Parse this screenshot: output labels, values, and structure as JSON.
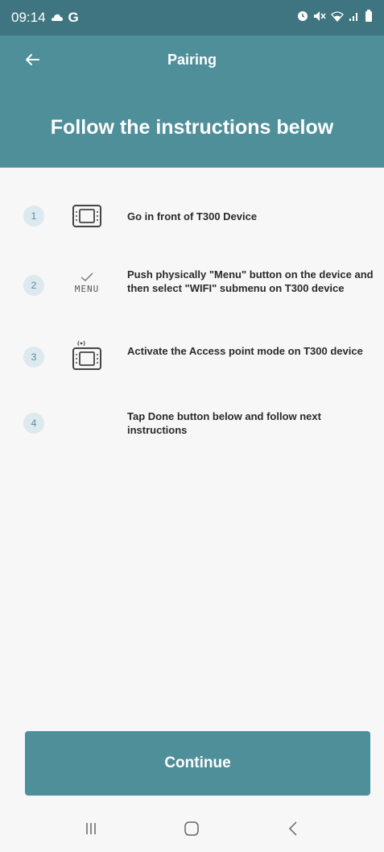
{
  "status_bar": {
    "time": "09:14",
    "carrier_letter": "G"
  },
  "app_bar": {
    "title": "Pairing",
    "headline": "Follow the instructions below"
  },
  "steps": [
    {
      "number": "1",
      "text": "Go in front of T300 Device",
      "icon": "device-icon"
    },
    {
      "number": "2",
      "text": "Push physically \"Menu\" button on the device and then select \"WIFI\" submenu on T300 device",
      "icon": "menu-check-icon",
      "icon_label": "MENU"
    },
    {
      "number": "3",
      "text": "Activate the Access point mode on T300 device",
      "icon": "device-wifi-icon"
    },
    {
      "number": "4",
      "text": "Tap Done button below and follow next instructions"
    }
  ],
  "continue_label": "Continue",
  "colors": {
    "primary": "#4f8f99",
    "status_bar": "#3f7580",
    "badge_bg": "#dce9ef",
    "badge_text": "#5b8a9a",
    "background": "#f7f7f8"
  }
}
